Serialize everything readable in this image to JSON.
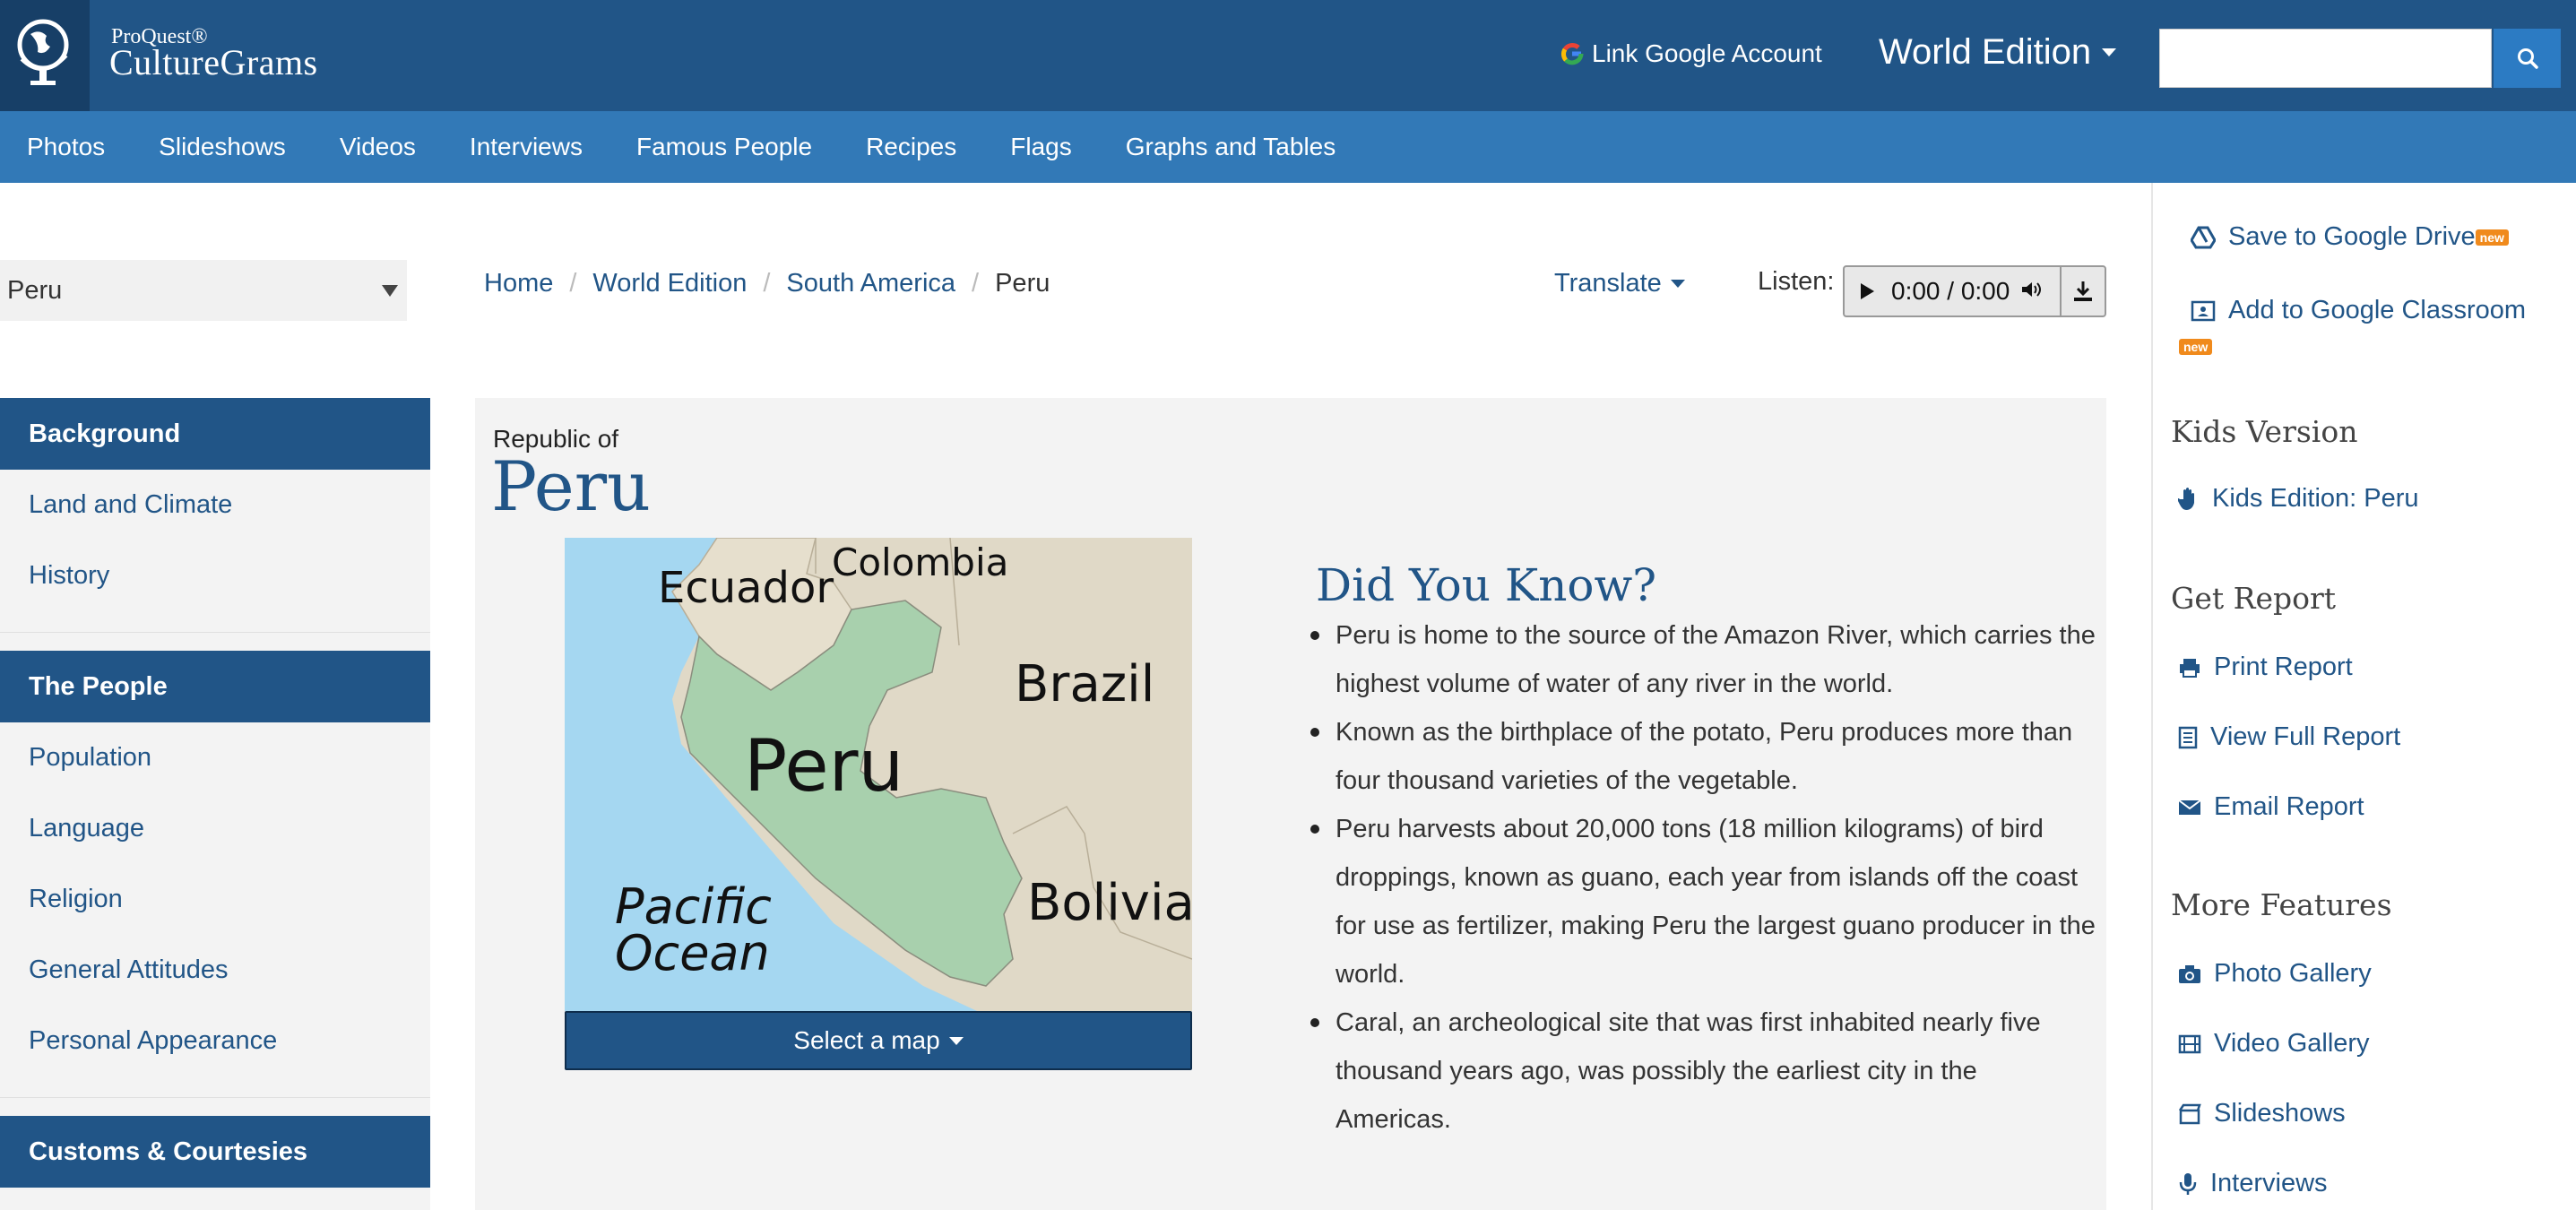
{
  "header": {
    "brand_small": "ProQuest®",
    "brand_name": "CultureGrams",
    "link_google": "Link Google Account",
    "edition": "World Edition",
    "search_placeholder": ""
  },
  "nav": {
    "items": [
      "Photos",
      "Slideshows",
      "Videos",
      "Interviews",
      "Famous People",
      "Recipes",
      "Flags",
      "Graphs and Tables"
    ]
  },
  "country_select": {
    "value": "Peru"
  },
  "breadcrumb": {
    "items": [
      "Home",
      "World Edition",
      "South America"
    ],
    "current": "Peru"
  },
  "toolbar": {
    "translate": "Translate",
    "listen": "Listen:",
    "player_time": "0:00 / 0:00"
  },
  "sidebar": {
    "sections": [
      {
        "title": "Background",
        "items": [
          "Land and Climate",
          "History"
        ]
      },
      {
        "title": "The People",
        "items": [
          "Population",
          "Language",
          "Religion",
          "General Attitudes",
          "Personal Appearance"
        ]
      },
      {
        "title": "Customs & Courtesies",
        "items": []
      }
    ]
  },
  "main": {
    "subtitle": "Republic of",
    "title": "Peru",
    "map_labels": {
      "ecuador": "Ecuador",
      "colombia": "Colombia",
      "brazil": "Brazil",
      "peru": "Peru",
      "pacific": "Pacific",
      "ocean": "Ocean",
      "bolivia": "Bolivia"
    },
    "map_button": "Select a map",
    "did_you_know_title": "Did You Know?",
    "facts": [
      "Peru is home to the source of the Amazon River, which carries the highest volume of water of any river in the world.",
      "Known as the birthplace of the potato, Peru produces more than four thousand varieties of the vegetable.",
      "Peru harvests about 20,000 tons (18 million kilograms) of bird droppings, known as guano, each year from islands off the coast for use as fertilizer, making Peru the largest guano producer in the world.",
      "Caral, an archeological site that was first inhabited nearly five thousand years ago, was possibly the earliest city in the Americas."
    ]
  },
  "right": {
    "save_drive": "Save to Google Drive",
    "add_classroom": "Add to Google Classroom",
    "new_badge": "new",
    "kids_heading": "Kids Version",
    "kids_link": "Kids Edition: Peru",
    "report_heading": "Get Report",
    "print_report": "Print Report",
    "view_report": "View Full Report",
    "email_report": "Email Report",
    "features_heading": "More Features",
    "photo_gallery": "Photo Gallery",
    "video_gallery": "Video Gallery",
    "slideshows": "Slideshows",
    "interviews": "Interviews"
  },
  "colors": {
    "header_dark": "#215587",
    "nav_blue": "#3279b7",
    "link_blue": "#215587",
    "badge_orange": "#f08a1c"
  }
}
